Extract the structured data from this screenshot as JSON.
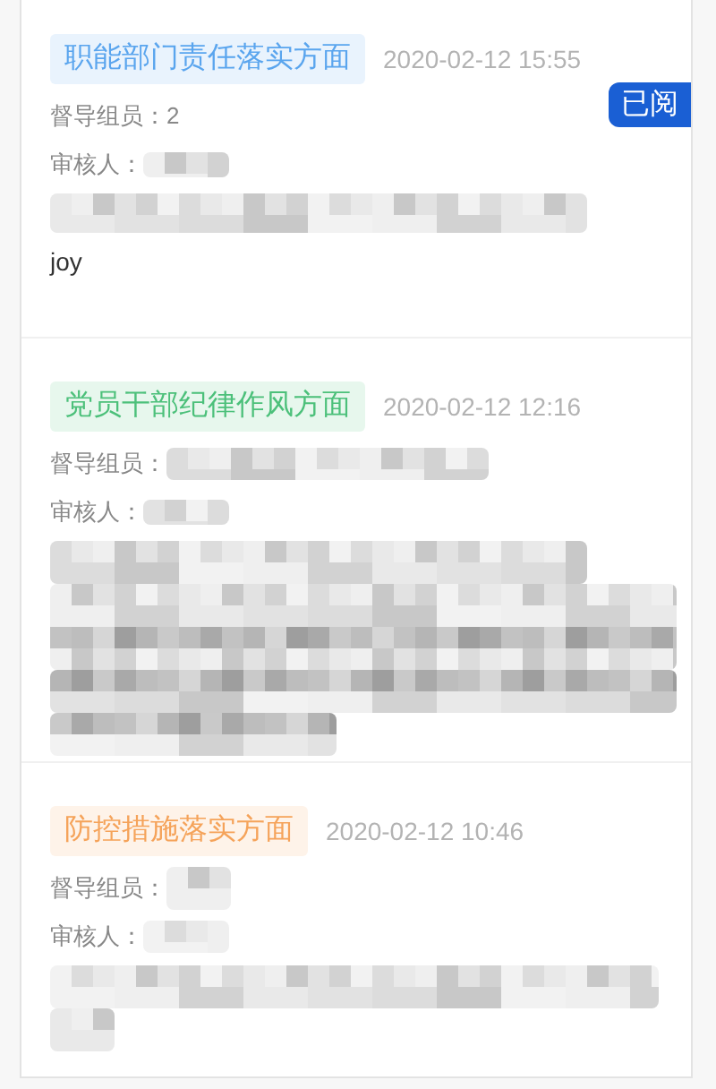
{
  "entries": [
    {
      "category": "职能部门责任落实方面",
      "color": "#5aa5ee",
      "time": "2020-02-12 15:55",
      "badge": "已阅",
      "members_label": "督导组员：",
      "members": "2",
      "reviewer_label": "审核人：",
      "note": "joy"
    },
    {
      "category": "党员干部纪律作风方面",
      "color": "#4cc07a",
      "time": "2020-02-12 12:16",
      "members_label": "督导组员：",
      "reviewer_label": "审核人："
    },
    {
      "category": "防控措施落实方面",
      "color": "#f5a35a",
      "time": "2020-02-12 10:46",
      "members_label": "督导组员：",
      "reviewer_label": "审核人："
    }
  ]
}
